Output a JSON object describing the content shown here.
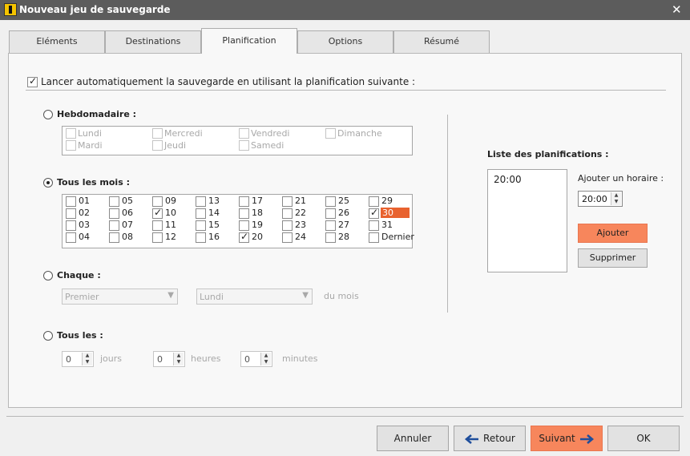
{
  "window": {
    "title": "Nouveau jeu de sauvegarde",
    "close_glyph": "✕"
  },
  "tabs": [
    "Eléments",
    "Destinations",
    "Planification",
    "Options",
    "Résumé"
  ],
  "active_tab": "Planification",
  "enable_schedule": {
    "label": "Lancer automatiquement la sauvegarde en utilisant la planification suivante :",
    "checked": true
  },
  "weekly": {
    "label": "Hebdomadaire :",
    "days": [
      "Lundi",
      "Mardi",
      "Mercredi",
      "Jeudi",
      "Vendredi",
      "Samedi",
      "Dimanche"
    ]
  },
  "monthly": {
    "label": "Tous les mois :",
    "days": [
      "01",
      "02",
      "03",
      "04",
      "05",
      "06",
      "07",
      "08",
      "09",
      "10",
      "11",
      "12",
      "13",
      "14",
      "15",
      "16",
      "17",
      "18",
      "19",
      "20",
      "21",
      "22",
      "23",
      "24",
      "25",
      "26",
      "27",
      "28",
      "29",
      "30",
      "31",
      "Dernier"
    ],
    "checked": [
      "10",
      "20",
      "30"
    ],
    "highlighted": "30"
  },
  "each": {
    "label": "Chaque :",
    "ordinal": "Premier",
    "weekday": "Lundi",
    "suffix": "du mois"
  },
  "every": {
    "label": "Tous les :",
    "days_value": "0",
    "days_unit": "jours",
    "hours_value": "0",
    "hours_unit": "heures",
    "minutes_value": "0",
    "minutes_unit": "minutes"
  },
  "schedule_list": {
    "title": "Liste des planifications :",
    "items": [
      "20:00"
    ]
  },
  "add_time": {
    "label": "Ajouter un horaire :",
    "value": "20:00",
    "add_button": "Ajouter",
    "remove_button": "Supprimer"
  },
  "footer": {
    "cancel": "Annuler",
    "back": "Retour",
    "next": "Suivant",
    "ok": "OK"
  },
  "colors": {
    "accent": "#f7865c",
    "highlight": "#e8622f"
  },
  "icons": {
    "app": "backup-app-icon",
    "back": "arrow-left-icon",
    "next": "arrow-right-icon"
  }
}
